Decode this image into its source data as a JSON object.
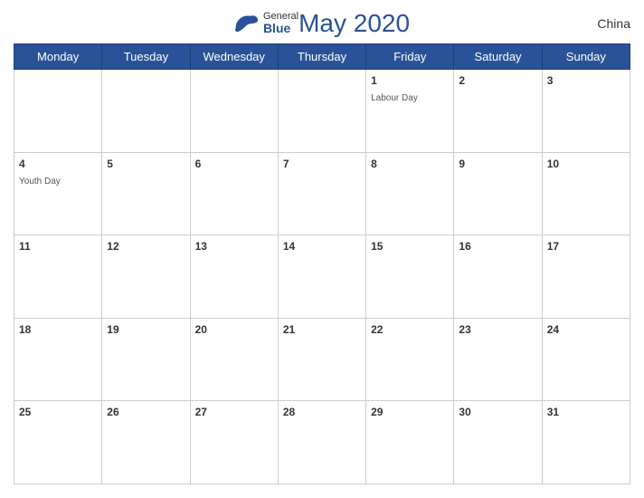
{
  "header": {
    "title": "May 2020",
    "country": "China",
    "logo": {
      "general": "General",
      "blue": "Blue"
    }
  },
  "weekdays": [
    "Monday",
    "Tuesday",
    "Wednesday",
    "Thursday",
    "Friday",
    "Saturday",
    "Sunday"
  ],
  "weeks": [
    [
      {
        "day": "",
        "holiday": ""
      },
      {
        "day": "",
        "holiday": ""
      },
      {
        "day": "",
        "holiday": ""
      },
      {
        "day": "",
        "holiday": ""
      },
      {
        "day": "1",
        "holiday": "Labour Day"
      },
      {
        "day": "2",
        "holiday": ""
      },
      {
        "day": "3",
        "holiday": ""
      }
    ],
    [
      {
        "day": "4",
        "holiday": "Youth Day"
      },
      {
        "day": "5",
        "holiday": ""
      },
      {
        "day": "6",
        "holiday": ""
      },
      {
        "day": "7",
        "holiday": ""
      },
      {
        "day": "8",
        "holiday": ""
      },
      {
        "day": "9",
        "holiday": ""
      },
      {
        "day": "10",
        "holiday": ""
      }
    ],
    [
      {
        "day": "11",
        "holiday": ""
      },
      {
        "day": "12",
        "holiday": ""
      },
      {
        "day": "13",
        "holiday": ""
      },
      {
        "day": "14",
        "holiday": ""
      },
      {
        "day": "15",
        "holiday": ""
      },
      {
        "day": "16",
        "holiday": ""
      },
      {
        "day": "17",
        "holiday": ""
      }
    ],
    [
      {
        "day": "18",
        "holiday": ""
      },
      {
        "day": "19",
        "holiday": ""
      },
      {
        "day": "20",
        "holiday": ""
      },
      {
        "day": "21",
        "holiday": ""
      },
      {
        "day": "22",
        "holiday": ""
      },
      {
        "day": "23",
        "holiday": ""
      },
      {
        "day": "24",
        "holiday": ""
      }
    ],
    [
      {
        "day": "25",
        "holiday": ""
      },
      {
        "day": "26",
        "holiday": ""
      },
      {
        "day": "27",
        "holiday": ""
      },
      {
        "day": "28",
        "holiday": ""
      },
      {
        "day": "29",
        "holiday": ""
      },
      {
        "day": "30",
        "holiday": ""
      },
      {
        "day": "31",
        "holiday": ""
      }
    ]
  ]
}
